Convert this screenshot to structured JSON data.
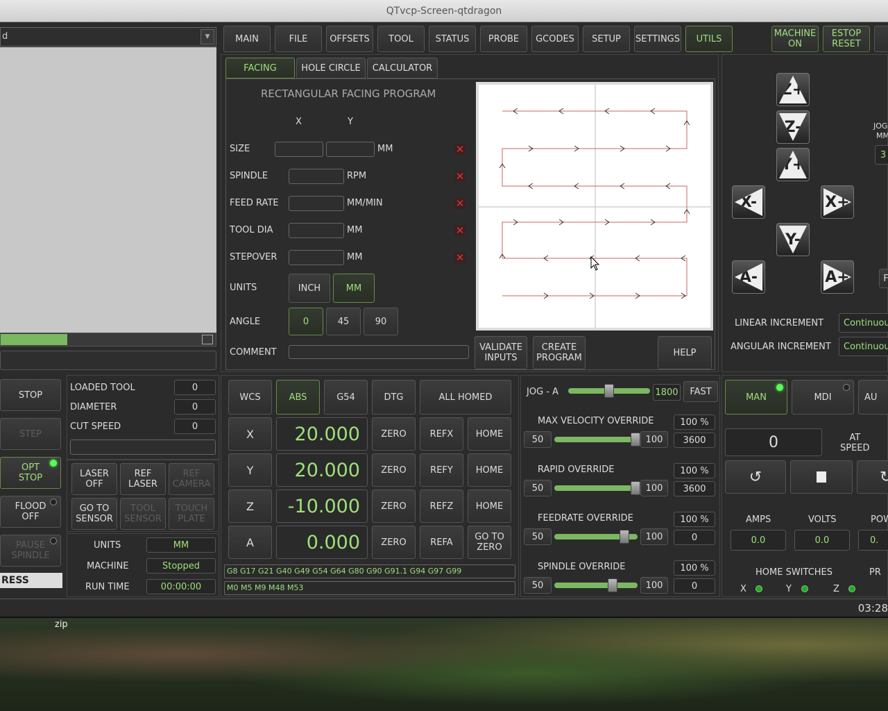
{
  "window": {
    "title": "QTvcp-Screen-qtdragon"
  },
  "file_panel": {
    "path_label": "d"
  },
  "main_tabs": [
    "MAIN",
    "FILE",
    "OFFSETS",
    "TOOL",
    "STATUS",
    "PROBE",
    "GCODES",
    "SETUP",
    "SETTINGS",
    "UTILS"
  ],
  "machine_on": "MACHINE\nON",
  "estop_reset": "ESTOP\nRESET",
  "sub_tabs": [
    "FACING",
    "HOLE CIRCLE",
    "CALCULATOR"
  ],
  "facing": {
    "title": "RECTANGULAR FACING PROGRAM",
    "col_x": "X",
    "col_y": "Y",
    "rows": [
      {
        "label": "SIZE",
        "unit": "MM"
      },
      {
        "label": "SPINDLE",
        "unit": "RPM"
      },
      {
        "label": "FEED RATE",
        "unit": "MM/MIN"
      },
      {
        "label": "TOOL DIA",
        "unit": "MM"
      },
      {
        "label": "STEPOVER",
        "unit": "MM"
      }
    ],
    "units_label": "UNITS",
    "inch": "INCH",
    "mm": "MM",
    "angle_label": "ANGLE",
    "angles": [
      "0",
      "45",
      "90"
    ],
    "comment_label": "COMMENT",
    "validate": "VALIDATE\nINPUTS",
    "create": "CREATE\nPROGRAM",
    "help": "HELP"
  },
  "jog_buttons": {
    "zplus": "Z+",
    "zminus": "Z-",
    "yplus": "Y+",
    "yminus": "Y-",
    "xminus": "X-",
    "xplus": "X+",
    "aminus": "A-",
    "aplus": "A+"
  },
  "jog_side": {
    "label1": "JOG",
    "label2": "MM",
    "value": "3",
    "f": "F"
  },
  "increments": {
    "linear_label": "LINEAR INCREMENT",
    "linear_value": "Continuou",
    "angular_label": "ANGULAR INCREMENT",
    "angular_value": "Continuou"
  },
  "left_controls": {
    "stop": "STOP",
    "step": "STEP",
    "opt_stop": "OPT\nSTOP",
    "flood_off": "FLOOD\nOFF",
    "pause_spindle": "PAUSE\nSPINDLE",
    "progress": "RESS"
  },
  "tool_info": {
    "loaded_tool_label": "LOADED TOOL",
    "loaded_tool": "0",
    "diameter_label": "DIAMETER",
    "diameter": "0",
    "cut_speed_label": "CUT SPEED",
    "cut_speed": "0"
  },
  "laser": {
    "laser_off": "LASER\nOFF",
    "ref_laser": "REF\nLASER",
    "ref_camera": "REF\nCAMERA",
    "go_to_sensor": "GO TO\nSENSOR",
    "tool_sensor": "TOOL\nSENSOR",
    "touch_plate": "TOUCH\nPLATE"
  },
  "status_info": {
    "units_label": "UNITS",
    "units": "MM",
    "machine_label": "MACHINE",
    "machine": "Stopped",
    "run_time_label": "RUN TIME",
    "run_time": "00:00:00"
  },
  "dro": {
    "wcs": "WCS",
    "abs": "ABS",
    "g54": "G54",
    "dtg": "DTG",
    "all_homed": "ALL HOMED",
    "axes": [
      {
        "axis": "X",
        "value": "20.000",
        "zero": "ZERO",
        "ref": "REFX",
        "home": "HOME"
      },
      {
        "axis": "Y",
        "value": "20.000",
        "zero": "ZERO",
        "ref": "REFY",
        "home": "HOME"
      },
      {
        "axis": "Z",
        "value": "-10.000",
        "zero": "ZERO",
        "ref": "REFZ",
        "home": "HOME"
      },
      {
        "axis": "A",
        "value": "0.000",
        "zero": "ZERO",
        "ref": "REFA",
        "home": "GO TO\nZERO"
      }
    ],
    "gcodes": "G8 G17 G21 G40 G49 G54 G64 G80 G90 G91.1 G94 G97 G99",
    "mcodes": "M0 M5 M9 M48 M53"
  },
  "overrides": {
    "jog_label": "JOG - A",
    "jog_value": "1800",
    "fast": "FAST",
    "items": [
      {
        "title": "MAX VELOCITY OVERRIDE",
        "percent": "100 %",
        "min": "50",
        "max": "100",
        "value": "3600",
        "level": 1.0
      },
      {
        "title": "RAPID OVERRIDE",
        "percent": "100 %",
        "min": "50",
        "max": "100",
        "value": "3600",
        "level": 1.0
      },
      {
        "title": "FEEDRATE OVERRIDE",
        "percent": "100 %",
        "min": "50",
        "max": "100",
        "value": "0",
        "level": 0.85
      },
      {
        "title": "SPINDLE OVERRIDE",
        "percent": "100 %",
        "min": "50",
        "max": "100",
        "value": "0",
        "level": 0.7
      }
    ]
  },
  "modes": {
    "man": "MAN",
    "mdi": "MDI",
    "auto": "AU"
  },
  "spindle": {
    "rpm": "0",
    "at_speed": "AT\nSPEED"
  },
  "meters": {
    "amps_label": "AMPS",
    "amps": "0.0",
    "volts_label": "VOLTS",
    "volts": "0.0",
    "power_label": "POW",
    "power": "0."
  },
  "home_switches": {
    "label": "HOME SWITCHES",
    "x": "X",
    "y": "Y",
    "z": "Z",
    "pr": "PR"
  },
  "statusbar": {
    "time": "03:28"
  },
  "desktop": {
    "icon_label": "zip"
  }
}
